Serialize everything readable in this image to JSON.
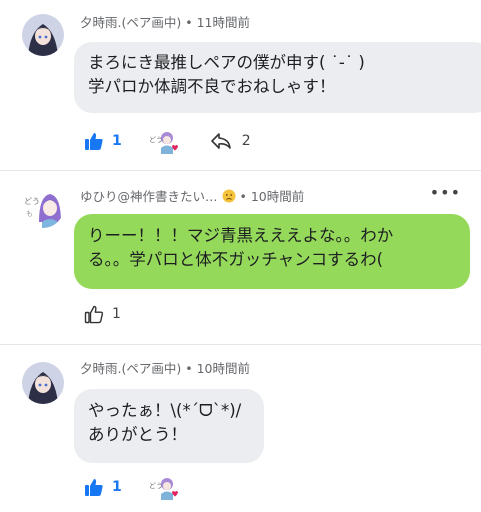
{
  "comments": [
    {
      "author": "夕時雨.(ペア画中)",
      "time": "11時間前",
      "lines": [
        "まろにき最推しペアの僕が申す( ˙-˙ )",
        "学パロか体調不良でおねしゃす！"
      ],
      "like_count": "1",
      "reply_count": "2"
    },
    {
      "author": "ゆひり@神作書きたい…",
      "time": "10時間前",
      "lines": [
        "りーー！！！マジ青黒えええよな。。わか",
        "る。。学パロと体不ガッチャンコするわ("
      ],
      "like_count": "1"
    },
    {
      "author": "夕時雨.(ペア画中)",
      "time": "10時間前",
      "lines": [
        "やったぁ！\\(*ˊᗜˋ*)/",
        "ありがとう！"
      ],
      "like_count": "1"
    }
  ],
  "separator": "•",
  "more_label": "•••",
  "colors": {
    "accent": "#1877f2",
    "bubble_gray": "#ebedf0",
    "bubble_green": "#95d95a"
  }
}
